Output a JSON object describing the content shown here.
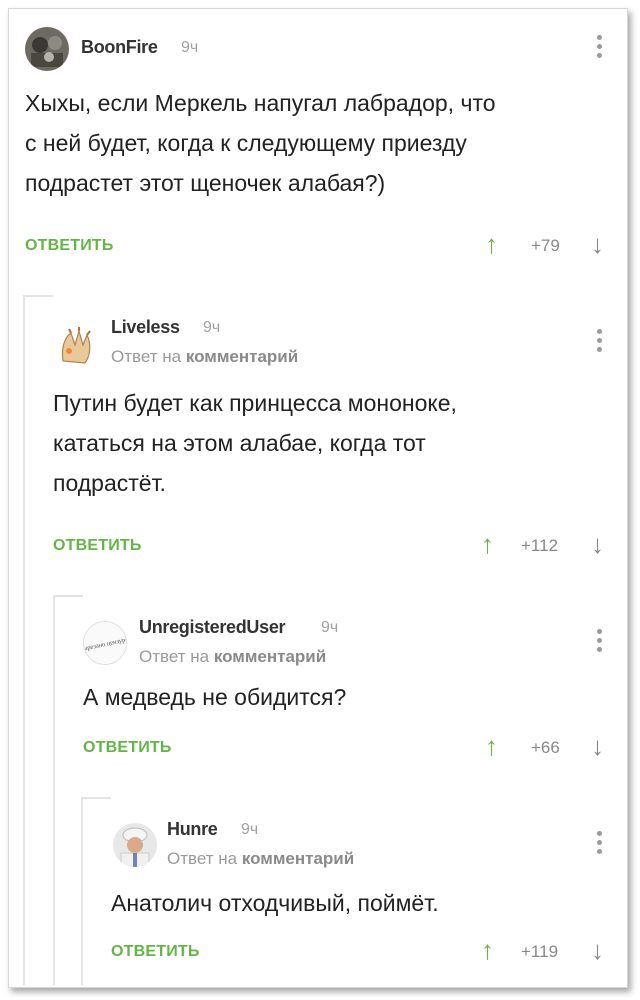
{
  "comments": [
    {
      "author": "BoonFire",
      "time": "9ч",
      "text_lines": [
        "Хыхы, если Меркель напугал лабрадор, что",
        "с ней будет, когда к следующему приезду",
        "подрастет этот щеночек алабая?)"
      ],
      "reply_label": "ОТВЕТИТЬ",
      "score": "+79"
    },
    {
      "author": "Liveless",
      "time": "9ч",
      "reply_to_prefix": "Ответ на",
      "reply_to_target": "комментарий",
      "text_lines": [
        "Путин будет как принцесса мононоке,",
        "кататься на этом алабае, когда тот",
        "подрастёт."
      ],
      "reply_label": "ОТВЕТИТЬ",
      "score": "+112"
    },
    {
      "author": "UnregisteredUser",
      "time": "9ч",
      "reply_to_prefix": "Ответ на",
      "reply_to_target": "комментарий",
      "avatar_text": "Вырезано цензурой",
      "text_lines": [
        "А медведь не обидится?"
      ],
      "reply_label": "ОТВЕТИТЬ",
      "score": "+66"
    },
    {
      "author": "Hunre",
      "time": "9ч",
      "reply_to_prefix": "Ответ на",
      "reply_to_target": "комментарий",
      "text_lines": [
        "Анатолич отходчивый, поймёт."
      ],
      "reply_label": "ОТВЕТИТЬ",
      "score": "+119"
    }
  ],
  "icons": {
    "upvote": "arrow-up",
    "downvote": "arrow-down",
    "menu": "more-vertical"
  },
  "colors": {
    "accent_green": "#63b645",
    "muted_gray": "#9a9a9a",
    "thread_line": "#e4e4e4"
  }
}
